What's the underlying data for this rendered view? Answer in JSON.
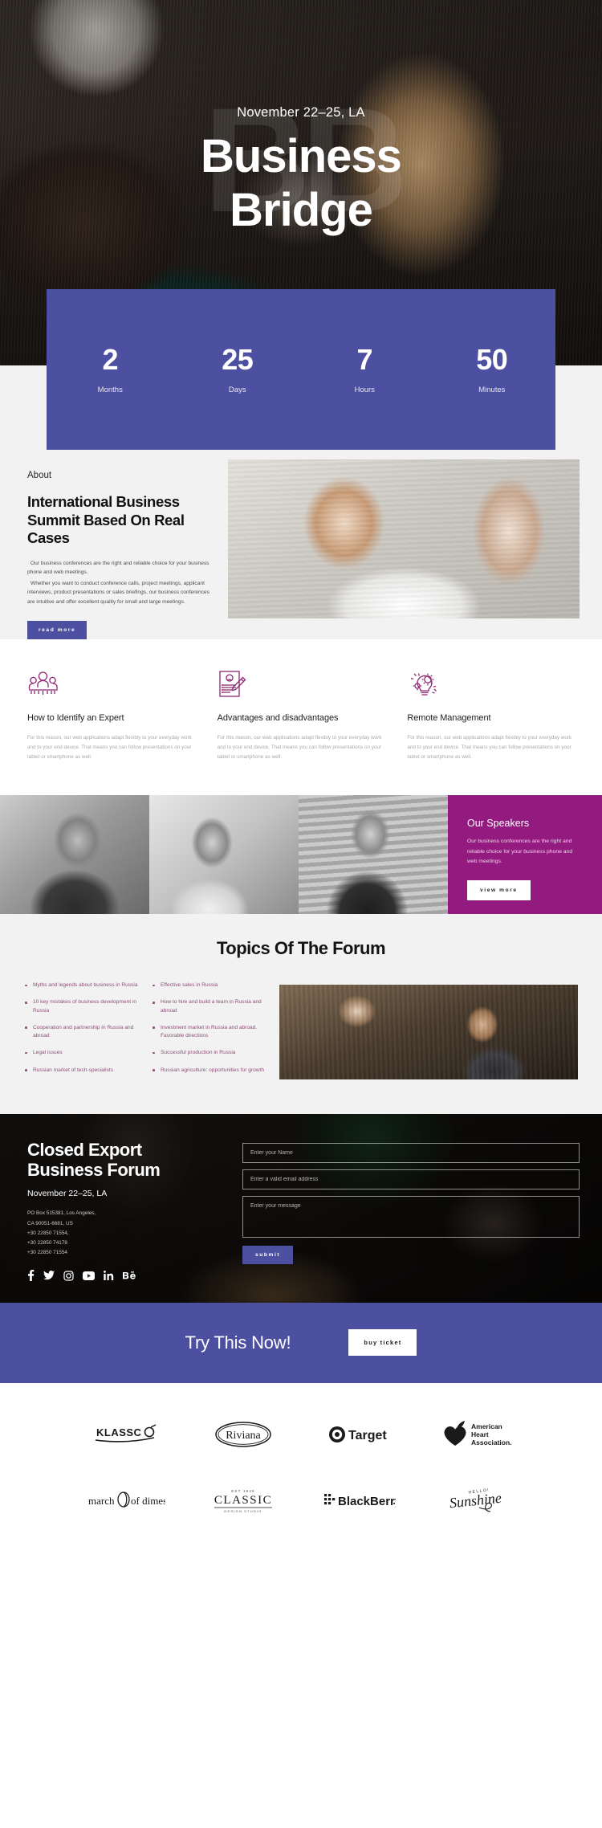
{
  "hero": {
    "watermark": "BB",
    "eyebrow": "November 22–25, LA",
    "title_line1": "Business",
    "title_line2": "Bridge"
  },
  "countdown": {
    "accent_color": "#4d4fa0",
    "cells": [
      {
        "value": "2",
        "label": "Months"
      },
      {
        "value": "25",
        "label": "Days"
      },
      {
        "value": "7",
        "label": "Hours"
      },
      {
        "value": "50",
        "label": "Minutes"
      }
    ]
  },
  "about": {
    "kicker": "About",
    "title": "International Business Summit Based On Real Cases",
    "paragraph1": "Our business conferences are the right and reliable choice for your business phone and web meetings.",
    "paragraph2": "Whether you want to conduct conference calls, project meetings, applicant interviews, product presentations or sales briefings, our business conferences are intuitive and offer excellent quality for small and large meetings.",
    "button": "read more",
    "image_alt": "woman laughing at business meeting table"
  },
  "features": {
    "body": "For this reason, our web applications adapt flexibly to your everyday work and to your end device. That means you can follow presentations on your tablet or smartphone as well.",
    "icon_color": "#8e2771",
    "items": [
      {
        "icon": "group-of-people-icon",
        "title": "How to Identify an Expert"
      },
      {
        "icon": "document-pen-icon",
        "title": "Advantages and disadvantages"
      },
      {
        "icon": "lightbulb-gear-icon",
        "title": "Remote Management"
      }
    ]
  },
  "speakers": {
    "panel_color": "#931b7f",
    "title": "Our Speakers",
    "body": "Our business conferences are the right and reliable choice for your business phone and web meetings.",
    "button": "view more",
    "photos": [
      "man in suit holding coffee cup",
      "woman with glasses smiling at laptop",
      "man in suit against wooden wall"
    ]
  },
  "topics": {
    "title": "Topics Of The Forum",
    "column1": [
      "Myths and legends about business in Russia",
      "10 key mistakes of business development in Russia",
      "Cooperation and partnership in Russia and abroad",
      "Legal issues",
      "Russian market of tech-specialists"
    ],
    "column2": [
      "Effective sales in Russia",
      "How to hire and build a team in Russia and abroad",
      "Investment market in Russia and abroad. Favorable directions",
      "Successful production in Russia",
      "Russian agriculture: opportunities for growth"
    ],
    "image_alt": "man seated at a forum audience"
  },
  "contact": {
    "heading_line1": "Closed Export",
    "heading_line2": "Business Forum",
    "date": "November 22–25, LA",
    "address": "PO Box 515381, Los Angeles,\nCA 90051-6681, US\n+30 22850 71554,\n+30 22850 74178\n+30 22850 71554",
    "address_lines": [
      "PO Box 515381, Los Angeles,",
      "CA 90051-6681, US",
      "+30 22850 71554,",
      "+30 22850 74178",
      "+30 22850 71554"
    ],
    "socials": [
      "facebook-icon",
      "twitter-icon",
      "instagram-icon",
      "youtube-icon",
      "linkedin-icon",
      "behance-icon"
    ],
    "form": {
      "name_placeholder": "Enter your Name",
      "email_placeholder": "Enter a valid email address",
      "message_placeholder": "Enter your message",
      "name_value": "",
      "email_value": "",
      "message_value": "",
      "submit_label": "submit"
    }
  },
  "cta": {
    "text": "Try This Now!",
    "button": "buy ticket",
    "background": "#4d4fa0"
  },
  "partners": {
    "row1": [
      "KLASSCO",
      "Riviana",
      "Target",
      "American Heart Association"
    ],
    "row2": [
      "march of dimes",
      "CLASSIC",
      "BlackBerry",
      "Sunshine"
    ],
    "classic_sub_top": "EST 1948",
    "classic_sub_bottom": "DESIGN STUDIO",
    "sunshine_top": "HELLO!"
  }
}
